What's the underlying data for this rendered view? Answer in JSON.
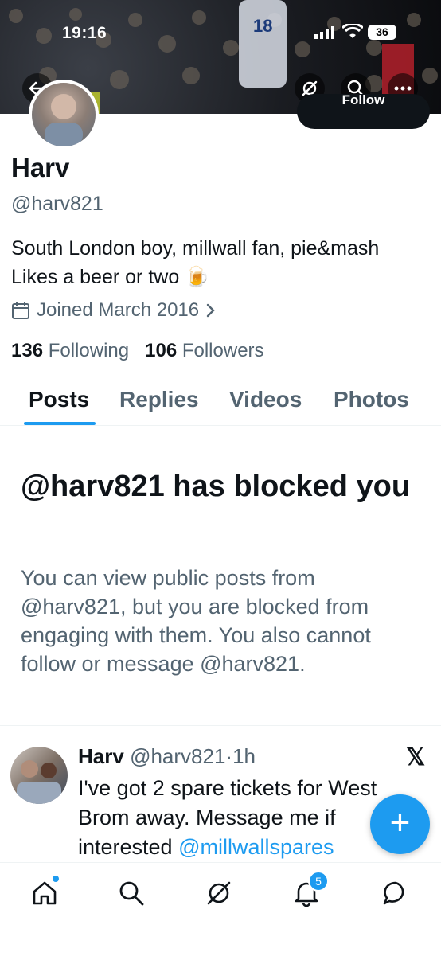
{
  "status_bar": {
    "time": "19:16",
    "battery": "36"
  },
  "profile": {
    "follow_label": "Follow",
    "name": "Harv",
    "handle": "@harv821",
    "bio": "South London boy, millwall fan, pie&mash Likes a beer or two 🍺",
    "joined": "Joined March 2016",
    "following_count": "136",
    "following_label": "Following",
    "followers_count": "106",
    "followers_label": "Followers"
  },
  "tabs": [
    {
      "label": "Posts",
      "active": true
    },
    {
      "label": "Replies",
      "active": false
    },
    {
      "label": "Videos",
      "active": false
    },
    {
      "label": "Photos",
      "active": false
    }
  ],
  "blocked": {
    "title": "@harv821 has blocked you",
    "description": "You can view public posts from @harv821, but you are blocked from engaging with them. You also cannot follow or message @harv821."
  },
  "post": {
    "name": "Harv",
    "handle": "@harv821",
    "separator": "·",
    "time": "1h",
    "text": "I've got 2 spare tickets for West Brom away. Message me if interested ",
    "mention": "@millwallspares"
  },
  "bottom_nav": {
    "notification_count": "5"
  },
  "icons": {
    "header": [
      "back-arrow-icon",
      "grok-icon",
      "search-icon",
      "more-icon"
    ],
    "nav": [
      "home-icon",
      "search-icon",
      "grok-icon",
      "bell-icon",
      "message-icon"
    ]
  },
  "colors": {
    "accent": "#1d9bf0",
    "text": "#0f1419",
    "muted": "#536471"
  }
}
